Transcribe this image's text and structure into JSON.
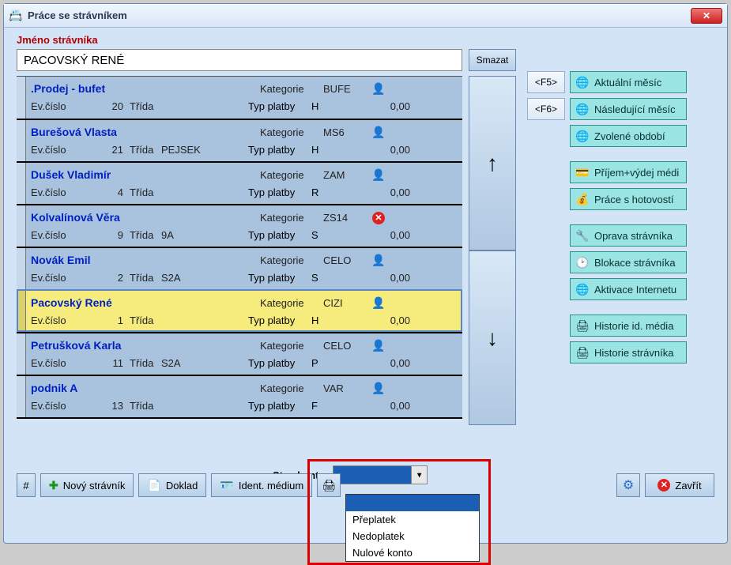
{
  "window": {
    "title": "Práce se strávníkem"
  },
  "labels": {
    "main": "Jméno strávníka",
    "smazat": "Smazat",
    "ev": "Ev.číslo",
    "trida": "Třída",
    "kategorie": "Kategorie",
    "typ": "Typ platby",
    "stav_konta": "Stav konta:"
  },
  "search": {
    "value": "PACOVSKÝ RENÉ"
  },
  "arrows": {
    "up": "↑",
    "down": "↓"
  },
  "keys": {
    "f5": "<F5>",
    "f6": "<F6>"
  },
  "actions": {
    "aktualniMesic": "Aktuální měsíc",
    "nasledujiciMesic": "Následující měsíc",
    "zvoleneObdobi": "Zvolené období",
    "prijemVydej": "Příjem+výdej médi",
    "praceHotovosti": "Práce s hotovostí",
    "opravaStravnika": "Oprava strávníka",
    "blokaceStravnika": "Blokace strávníka",
    "aktivaceInternetu": "Aktivace Internetu",
    "historieMedia": "Historie id. média",
    "historieStravnika": "Historie strávníka"
  },
  "toolbar": {
    "hash": "#",
    "novy": "Nový strávník",
    "doklad": "Doklad",
    "ident": "Ident. médium",
    "zavrit": "Zavřít"
  },
  "dropdown": {
    "selected": "",
    "options": [
      "",
      "Přeplatek",
      "Nedoplatek",
      "Nulové konto"
    ]
  },
  "rows": [
    {
      "name": ".Prodej - bufet",
      "ev": "20",
      "trida": "",
      "kat": "BUFE",
      "typ": "H",
      "amt": "0,00",
      "status": "ok",
      "selected": false
    },
    {
      "name": "Burešová Vlasta",
      "ev": "21",
      "trida": "PEJSEK",
      "kat": "MS6",
      "typ": "H",
      "amt": "0,00",
      "status": "ok",
      "selected": false
    },
    {
      "name": "Dušek Vladimír",
      "ev": "4",
      "trida": "",
      "kat": "ZAM",
      "typ": "R",
      "amt": "0,00",
      "status": "ok",
      "selected": false
    },
    {
      "name": "Kolvalínová Věra",
      "ev": "9",
      "trida": "9A",
      "kat": "ZS14",
      "typ": "S",
      "amt": "0,00",
      "status": "bad",
      "selected": false
    },
    {
      "name": "Novák Emil",
      "ev": "2",
      "trida": "S2A",
      "kat": "CELO",
      "typ": "S",
      "amt": "0,00",
      "status": "ok",
      "selected": false
    },
    {
      "name": "Pacovský René",
      "ev": "1",
      "trida": "",
      "kat": "CIZI",
      "typ": "H",
      "amt": "0,00",
      "status": "ok",
      "selected": true
    },
    {
      "name": "Petrušková Karla",
      "ev": "11",
      "trida": "S2A",
      "kat": "CELO",
      "typ": "P",
      "amt": "0,00",
      "status": "ok",
      "selected": false
    },
    {
      "name": "podnik A",
      "ev": "13",
      "trida": "",
      "kat": "VAR",
      "typ": "F",
      "amt": "0,00",
      "status": "ok",
      "selected": false
    }
  ]
}
